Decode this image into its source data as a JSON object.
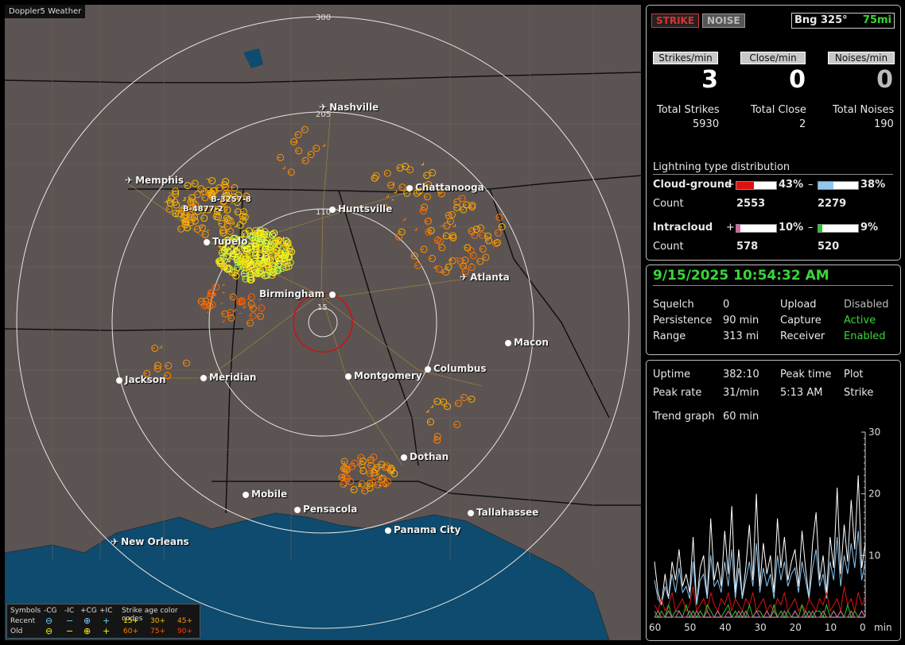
{
  "app_title": "Doppler5 Weather",
  "map": {
    "ring_labels": [
      "300",
      "205",
      "110",
      "15"
    ],
    "cities": [
      {
        "name": "Nashville",
        "icon": "plane"
      },
      {
        "name": "Memphis",
        "icon": "plane"
      },
      {
        "name": "Chattanooga",
        "icon": "dot"
      },
      {
        "name": "Huntsville",
        "icon": "dot"
      },
      {
        "name": "Tupelo",
        "icon": "dot"
      },
      {
        "name": "Atlanta",
        "icon": "plane"
      },
      {
        "name": "Birmingham",
        "icon": "dot"
      },
      {
        "name": "Macon",
        "icon": "dot"
      },
      {
        "name": "Jackson",
        "icon": "dot"
      },
      {
        "name": "Meridian",
        "icon": "dot"
      },
      {
        "name": "Montgomery",
        "icon": "dot"
      },
      {
        "name": "Columbus",
        "icon": "dot"
      },
      {
        "name": "Dothan",
        "icon": "dot"
      },
      {
        "name": "Mobile",
        "icon": "dot"
      },
      {
        "name": "Pensacola",
        "icon": "dot"
      },
      {
        "name": "Tallahassee",
        "icon": "dot"
      },
      {
        "name": "Panama City",
        "icon": "dot"
      },
      {
        "name": "New Orleans",
        "icon": "plane"
      }
    ],
    "markers": [
      "B-3257-8",
      "B-4877-2"
    ]
  },
  "legend": {
    "symbols_label": "Symbols",
    "col_ncg": "-CG",
    "col_nic": "-IC",
    "col_pcg": "+CG",
    "col_pic": "+IC",
    "age_label": "Strike age color codes",
    "recent_label": "Recent",
    "old_label": "Old",
    "recent_ages": [
      "15+",
      "30+",
      "45+"
    ],
    "old_ages": [
      "60+",
      "75+",
      "90+"
    ],
    "symbol_glyphs": {
      "ncg": "⊖",
      "nic": "−",
      "pcg": "⊕",
      "pic": "+"
    }
  },
  "panel1": {
    "strike_button": "STRIKE",
    "noise_button": "NOISE",
    "bearing": "Bng 325°",
    "range": "75mi",
    "strikes_min_hdr": "Strikes/min",
    "close_min_hdr": "Close/min",
    "noises_min_hdr": "Noises/min",
    "strikes_min": "3",
    "close_min": "0",
    "noises_min": "0",
    "total_strikes_label": "Total Strikes",
    "total_close_label": "Total Close",
    "total_noises_label": "Total Noises",
    "total_strikes": "5930",
    "total_close": "2",
    "total_noises": "190",
    "dist_title": "Lightning type distribution",
    "cg_label": "Cloud-ground",
    "ic_label": "Intracloud",
    "count_label": "Count",
    "plus_sign": "+",
    "minus_sign": "–",
    "cg_pos_pct": "43%",
    "cg_pos_frac": 0.43,
    "cg_neg_pct": "38%",
    "cg_neg_frac": 0.38,
    "ic_pos_pct": "10%",
    "ic_pos_frac": 0.1,
    "ic_neg_pct": "9%",
    "ic_neg_frac": 0.09,
    "cg_pos_count": "2553",
    "cg_neg_count": "2279",
    "ic_pos_count": "578",
    "ic_neg_count": "520",
    "colors": {
      "cg_pos": "#e01010",
      "cg_neg": "#8ec6f0",
      "ic_pos": "#e060a0",
      "ic_neg": "#22cc22"
    }
  },
  "panel2": {
    "datetime": "9/15/2025 10:54:32 AM",
    "squelch_label": "Squelch",
    "squelch": "0",
    "persistence_label": "Persistence",
    "persistence": "90 min",
    "range_label": "Range",
    "range": "313 mi",
    "upload_label": "Upload",
    "upload": "Disabled",
    "capture_label": "Capture",
    "capture": "Active",
    "receiver_label": "Receiver",
    "receiver": "Enabled"
  },
  "panel3": {
    "uptime_label": "Uptime",
    "uptime": "382:10",
    "peak_time_label": "Peak time",
    "peak_time": "5:13 AM",
    "plot_label": "Plot",
    "plot": "Strike",
    "peak_rate_label": "Peak rate",
    "peak_rate": "31/min",
    "trend_label": "Trend graph",
    "trend": "60 min"
  },
  "chart_data": {
    "type": "line",
    "title": "",
    "xlabel": "min",
    "ylabel": "",
    "x_ticks": [
      "60",
      "50",
      "40",
      "30",
      "20",
      "10",
      "0"
    ],
    "y_ticks": [
      "30",
      "20",
      "10"
    ],
    "xlim": [
      60,
      0
    ],
    "ylim": [
      0,
      30
    ],
    "series": [
      {
        "color": "#ffffff",
        "values": [
          9,
          4,
          2,
          7,
          3,
          9,
          6,
          11,
          5,
          7,
          4,
          13,
          2,
          8,
          10,
          3,
          16,
          6,
          9,
          5,
          14,
          7,
          18,
          4,
          11,
          3,
          8,
          15,
          6,
          20,
          5,
          12,
          7,
          10,
          4,
          16,
          8,
          13,
          6,
          9,
          11,
          5,
          14,
          8,
          3,
          12,
          17,
          6,
          10,
          4,
          13,
          8,
          21,
          7,
          15,
          9,
          19,
          11,
          23,
          8,
          12
        ]
      },
      {
        "color": "#8ec6f0",
        "values": [
          6,
          3,
          2,
          5,
          3,
          7,
          4,
          8,
          4,
          5,
          3,
          9,
          2,
          6,
          7,
          3,
          10,
          5,
          6,
          4,
          9,
          5,
          11,
          3,
          8,
          3,
          6,
          9,
          5,
          12,
          4,
          8,
          5,
          7,
          3,
          10,
          6,
          9,
          5,
          7,
          8,
          4,
          9,
          6,
          3,
          8,
          11,
          5,
          7,
          3,
          9,
          6,
          13,
          5,
          10,
          7,
          12,
          8,
          14,
          6,
          9
        ]
      },
      {
        "color": "#e01010",
        "values": [
          2,
          1,
          3,
          1,
          2,
          4,
          1,
          2,
          3,
          1,
          2,
          5,
          1,
          2,
          3,
          1,
          4,
          2,
          1,
          3,
          2,
          4,
          1,
          3,
          2,
          1,
          3,
          2,
          4,
          1,
          2,
          3,
          1,
          2,
          1,
          3,
          2,
          4,
          1,
          2,
          3,
          1,
          2,
          1,
          3,
          2,
          1,
          3,
          2,
          4,
          1,
          2,
          3,
          1,
          5,
          2,
          3,
          1,
          4,
          2,
          3
        ]
      },
      {
        "color": "#22cc22",
        "values": [
          1,
          0,
          1,
          0,
          2,
          0,
          1,
          1,
          0,
          2,
          0,
          1,
          0,
          1,
          0,
          2,
          1,
          0,
          1,
          0,
          1,
          2,
          0,
          1,
          0,
          1,
          0,
          2,
          0,
          1,
          1,
          0,
          1,
          0,
          2,
          0,
          1,
          0,
          1,
          0,
          1,
          0,
          2,
          0,
          1,
          0,
          1,
          1,
          0,
          2,
          0,
          1,
          0,
          1,
          0,
          2,
          0,
          1,
          0,
          1,
          0
        ]
      },
      {
        "color": "#e060a0",
        "values": [
          0,
          1,
          0,
          0,
          1,
          0,
          0,
          1,
          0,
          0,
          1,
          0,
          1,
          0,
          0,
          1,
          0,
          0,
          1,
          0,
          0,
          1,
          0,
          0,
          1,
          0,
          1,
          0,
          0,
          1,
          0,
          0,
          1,
          0,
          1,
          0,
          0,
          1,
          0,
          0,
          1,
          0,
          0,
          1,
          0,
          1,
          0,
          0,
          1,
          0,
          0,
          1,
          0,
          1,
          0,
          0,
          1,
          0,
          0,
          1,
          0
        ]
      }
    ]
  }
}
